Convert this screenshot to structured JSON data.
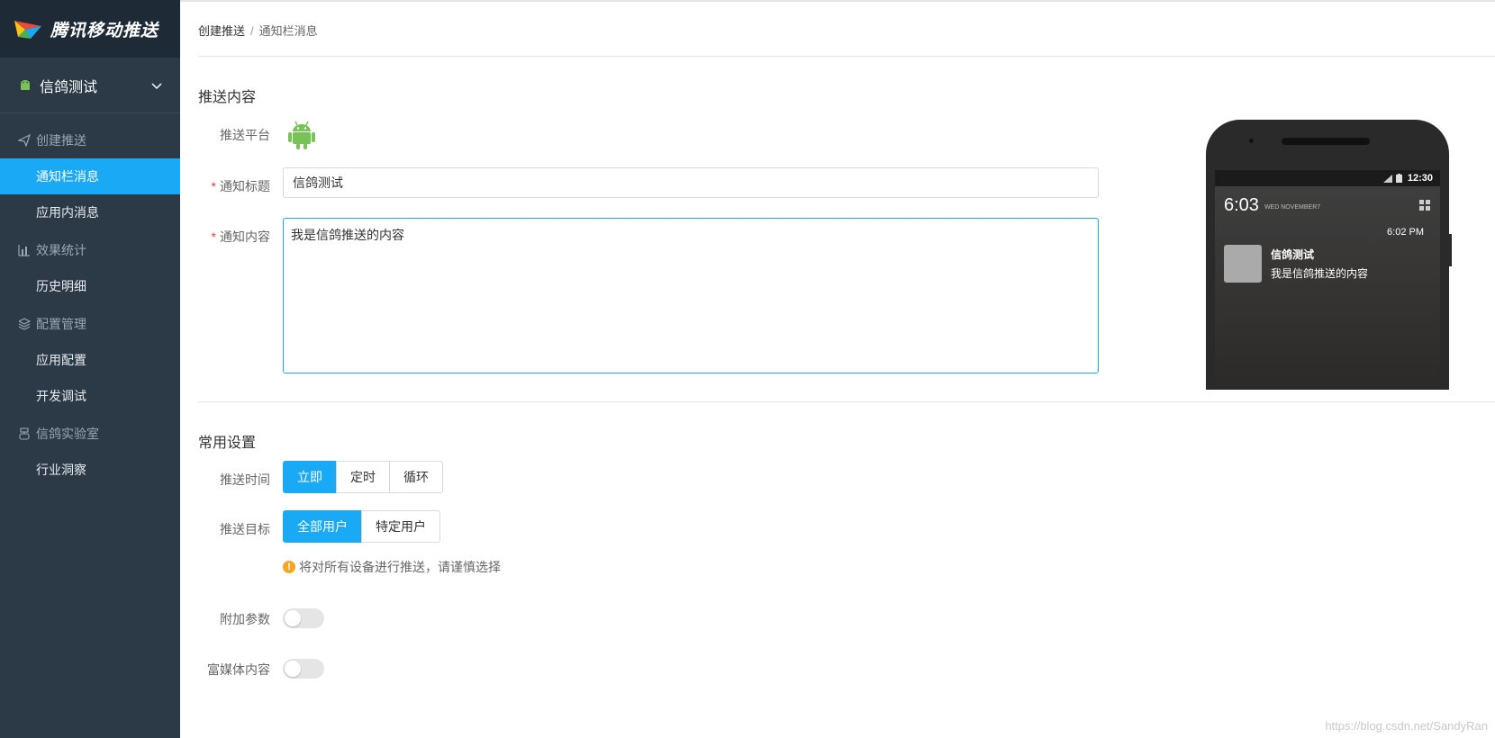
{
  "brand": {
    "name": "腾讯移动推送"
  },
  "app_selector": {
    "name": "信鸽测试",
    "icon": "android-icon"
  },
  "sidebar": {
    "groups": [
      {
        "title": "创建推送",
        "icon": "paper-plane-icon",
        "items": [
          "通知栏消息",
          "应用内消息"
        ]
      },
      {
        "title": "效果统计",
        "icon": "bar-chart-icon",
        "items": [
          "历史明细"
        ]
      },
      {
        "title": "配置管理",
        "icon": "layers-icon",
        "items": [
          "应用配置",
          "开发调试"
        ]
      },
      {
        "title": "信鸽实验室",
        "icon": "flask-icon",
        "items": [
          "行业洞察"
        ]
      }
    ],
    "active_item": "通知栏消息"
  },
  "breadcrumb": {
    "first": "创建推送",
    "separator": "/",
    "current": "通知栏消息"
  },
  "push_content": {
    "section_title": "推送内容",
    "platform_label": "推送平台",
    "platform_icon": "android-icon",
    "title_label": "通知标题",
    "title_value": "信鸽测试",
    "content_label": "通知内容",
    "content_value": "我是信鸽推送的内容",
    "required_mark": "*"
  },
  "common_settings": {
    "section_title": "常用设置",
    "time_label": "推送时间",
    "time_options": [
      "立即",
      "定时",
      "循环"
    ],
    "time_selected": "立即",
    "target_label": "推送目标",
    "target_options": [
      "全部用户",
      "特定用户"
    ],
    "target_selected": "全部用户",
    "warning_text": "将对所有设备进行推送，请谨慎选择",
    "extra_params_label": "附加参数",
    "extra_params_on": false,
    "rich_media_label": "富媒体内容",
    "rich_media_on": false
  },
  "preview": {
    "status_time": "12:30",
    "big_time": "6:03",
    "date": "WED NOVEMBER7",
    "notif_time": "6:02 PM",
    "notif_title": "信鸽测试",
    "notif_body": "我是信鸽推送的内容"
  },
  "watermark": "https://blog.csdn.net/SandyRan",
  "colors": {
    "accent": "#1aa9f5",
    "sidebar": "#2c3a47",
    "android": "#78c257",
    "warning": "#f5a623",
    "required": "#f04134"
  }
}
